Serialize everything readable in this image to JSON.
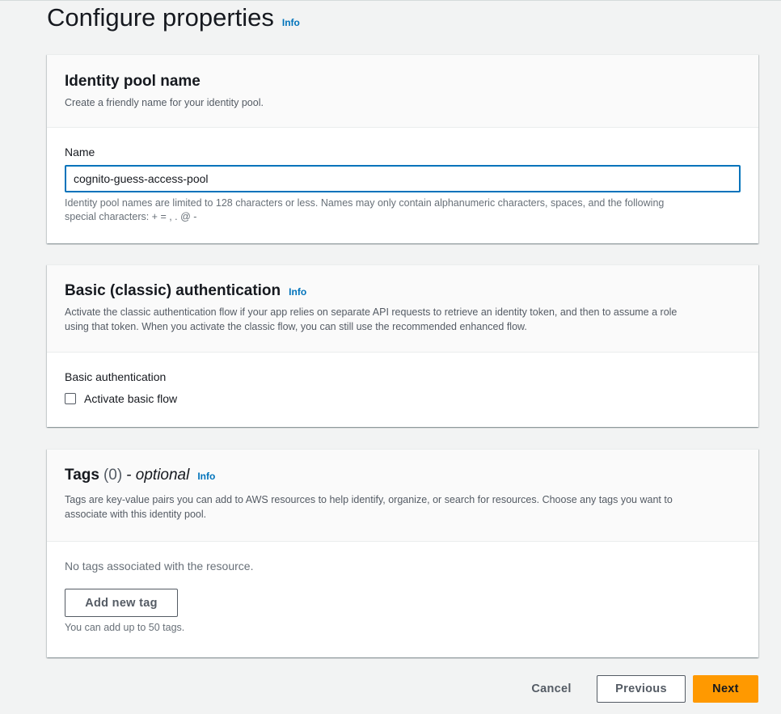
{
  "page": {
    "title": "Configure properties",
    "info": "Info"
  },
  "identity_pool": {
    "title": "Identity pool name",
    "description": "Create a friendly name for your identity pool.",
    "name_label": "Name",
    "name_value": "cognito-guess-access-pool",
    "constraint_line1": "Identity pool names are limited to 128 characters or less. Names may only contain alphanumeric characters, spaces, and the following",
    "constraint_line2": "special characters: + = , . @ -"
  },
  "basic_auth": {
    "title": "Basic (classic) authentication",
    "info": "Info",
    "description_line1": "Activate the classic authentication flow if your app relies on separate API requests to retrieve an identity token, and then to assume a role",
    "description_line2": "using that token. When you activate the classic flow, you can still use the recommended enhanced flow.",
    "field_label": "Basic authentication",
    "checkbox_label": "Activate basic flow",
    "checkbox_checked": false
  },
  "tags": {
    "title": "Tags",
    "count": "(0)",
    "optional": "- optional",
    "info": "Info",
    "description_line1": "Tags are key-value pairs you can add to AWS resources to help identify, organize, or search for resources. Choose any tags you want to",
    "description_line2": "associate with this identity pool.",
    "empty_text": "No tags associated with the resource.",
    "add_button": "Add new tag",
    "hint": "You can add up to 50 tags."
  },
  "footer": {
    "cancel": "Cancel",
    "previous": "Previous",
    "next": "Next"
  },
  "colors": {
    "accent": "#0073bb",
    "primary_button": "#ff9900",
    "background": "#f2f3f3"
  }
}
